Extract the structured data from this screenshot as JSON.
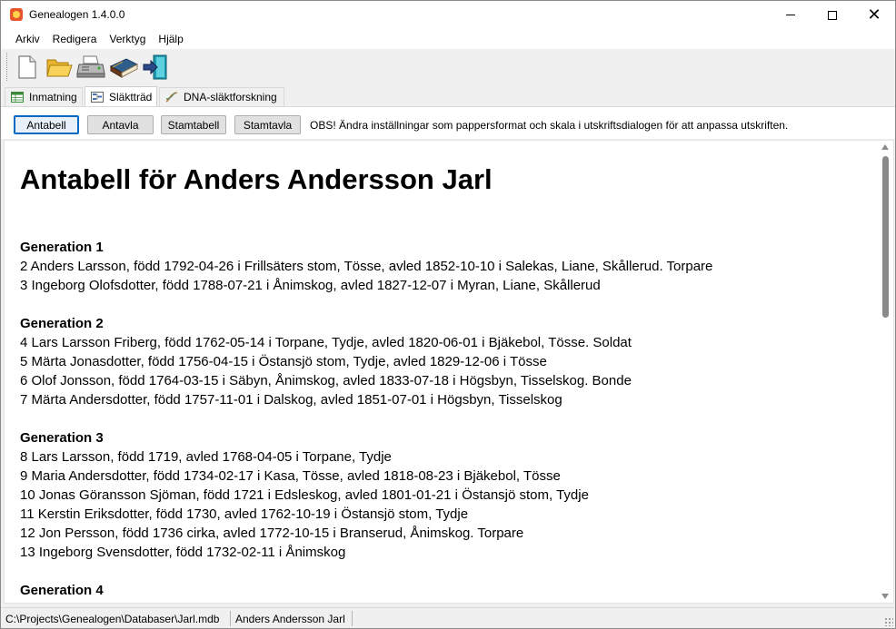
{
  "window": {
    "title": "Genealogen 1.4.0.0",
    "controls": {
      "minimize": "minimize-icon",
      "maximize": "maximize-icon",
      "close": "close-icon"
    }
  },
  "menu": {
    "items": [
      {
        "label": "Arkiv"
      },
      {
        "label": "Redigera"
      },
      {
        "label": "Verktyg"
      },
      {
        "label": "Hjälp"
      }
    ]
  },
  "toolbar": {
    "buttons": [
      {
        "icon": "new-document-icon"
      },
      {
        "icon": "open-folder-icon"
      },
      {
        "icon": "printer-icon"
      },
      {
        "icon": "book-icon"
      },
      {
        "icon": "exit-icon"
      }
    ]
  },
  "tabs": [
    {
      "label": "Inmatning",
      "icon": "table-icon",
      "active": false
    },
    {
      "label": "Släktträd",
      "icon": "tree-icon",
      "active": true
    },
    {
      "label": "DNA-släktforskning",
      "icon": "dna-icon",
      "active": false
    }
  ],
  "report_buttons": [
    {
      "label": "Antabell",
      "default": true
    },
    {
      "label": "Antavla"
    },
    {
      "label": "Stamtabell"
    },
    {
      "label": "Stamtavla"
    }
  ],
  "notice": "OBS! Ändra inställningar som pappersformat och skala i utskriftsdialogen för att anpassa utskriften.",
  "report": {
    "title": "Antabell för Anders Andersson Jarl",
    "generations": [
      {
        "heading": "Generation 1",
        "lines": [
          "2 Anders Larsson, född 1792-04-26 i Frillsäters stom, Tösse, avled 1852-10-10 i Salekas, Liane, Skållerud. Torpare",
          "3 Ingeborg Olofsdotter, född 1788-07-21 i Ånimskog, avled 1827-12-07 i Myran, Liane, Skållerud"
        ]
      },
      {
        "heading": "Generation 2",
        "lines": [
          "4 Lars Larsson Friberg, född 1762-05-14 i Torpane, Tydje, avled 1820-06-01 i Bjäkebol, Tösse. Soldat",
          "5 Märta Jonasdotter, född 1756-04-15 i Östansjö stom, Tydje, avled 1829-12-06 i Tösse",
          "6 Olof Jonsson, född 1764-03-15 i Säbyn, Ånimskog, avled 1833-07-18 i Högsbyn, Tisselskog. Bonde",
          "7 Märta Andersdotter, född 1757-11-01 i Dalskog, avled 1851-07-01 i Högsbyn, Tisselskog"
        ]
      },
      {
        "heading": "Generation 3",
        "lines": [
          "8 Lars Larsson, född 1719, avled 1768-04-05 i Torpane, Tydje",
          "9 Maria Andersdotter, född 1734-02-17 i Kasa, Tösse, avled 1818-08-23 i Bjäkebol, Tösse",
          "10 Jonas Göransson Sjöman, född 1721 i Edsleskog, avled 1801-01-21 i Östansjö stom, Tydje",
          "11 Kerstin Eriksdotter, född 1730, avled 1762-10-19 i Östansjö stom, Tydje",
          "12 Jon Persson, född 1736 cirka, avled 1772-10-15 i Branserud, Ånimskog. Torpare",
          "13 Ingeborg Svensdotter, född 1732-02-11 i Ånimskog"
        ]
      },
      {
        "heading": "Generation 4",
        "lines": []
      }
    ]
  },
  "status": {
    "path": "C:\\Projects\\Genealogen\\Databaser\\Jarl.mdb",
    "person": "Anders Andersson Jarl"
  }
}
